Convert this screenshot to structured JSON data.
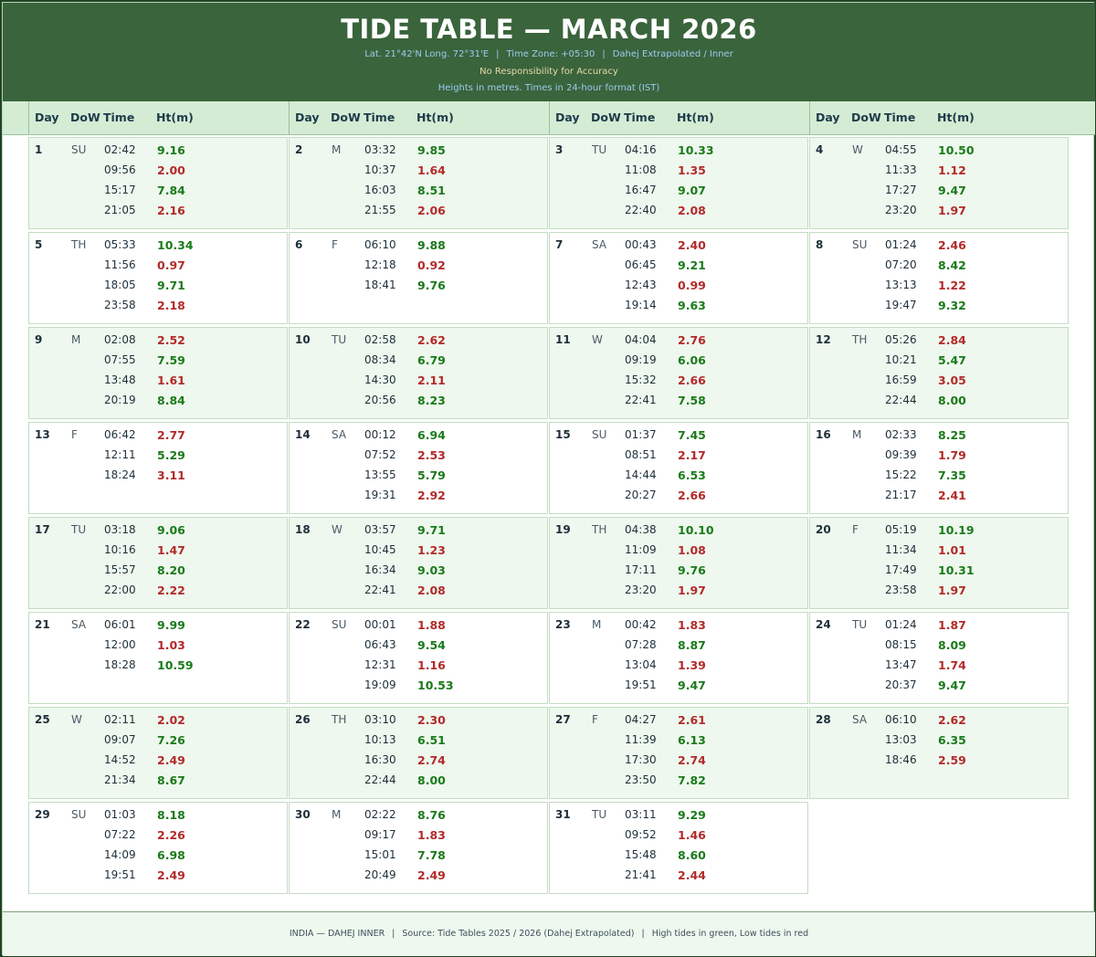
{
  "header": {
    "title": "TIDE TABLE — MARCH 2026",
    "location_line": {
      "coords": "Lat. 21°42'N  Long. 72°31'E",
      "timezone": "Time Zone: +05:30",
      "station": "Dahej Extrapolated / Inner",
      "separator": "|"
    },
    "disclaimer": "No Responsibility for Accuracy",
    "units_note": "Heights in metres.  Times in 24-hour format (IST)"
  },
  "columns": {
    "day": "Day",
    "dow": "DoW",
    "time": "Time",
    "height": "Ht(m)"
  },
  "days": [
    {
      "day": "1",
      "dow": "SU",
      "tides": [
        {
          "t": "02:42",
          "h": "9.16",
          "type": "high"
        },
        {
          "t": "09:56",
          "h": "2.00",
          "type": "low"
        },
        {
          "t": "15:17",
          "h": "7.84",
          "type": "high"
        },
        {
          "t": "21:05",
          "h": "2.16",
          "type": "low"
        }
      ]
    },
    {
      "day": "2",
      "dow": "M",
      "tides": [
        {
          "t": "03:32",
          "h": "9.85",
          "type": "high"
        },
        {
          "t": "10:37",
          "h": "1.64",
          "type": "low"
        },
        {
          "t": "16:03",
          "h": "8.51",
          "type": "high"
        },
        {
          "t": "21:55",
          "h": "2.06",
          "type": "low"
        }
      ]
    },
    {
      "day": "3",
      "dow": "TU",
      "tides": [
        {
          "t": "04:16",
          "h": "10.33",
          "type": "high"
        },
        {
          "t": "11:08",
          "h": "1.35",
          "type": "low"
        },
        {
          "t": "16:47",
          "h": "9.07",
          "type": "high"
        },
        {
          "t": "22:40",
          "h": "2.08",
          "type": "low"
        }
      ]
    },
    {
      "day": "4",
      "dow": "W",
      "tides": [
        {
          "t": "04:55",
          "h": "10.50",
          "type": "high"
        },
        {
          "t": "11:33",
          "h": "1.12",
          "type": "low"
        },
        {
          "t": "17:27",
          "h": "9.47",
          "type": "high"
        },
        {
          "t": "23:20",
          "h": "1.97",
          "type": "low"
        }
      ]
    },
    {
      "day": "5",
      "dow": "TH",
      "tides": [
        {
          "t": "05:33",
          "h": "10.34",
          "type": "high"
        },
        {
          "t": "11:56",
          "h": "0.97",
          "type": "low"
        },
        {
          "t": "18:05",
          "h": "9.71",
          "type": "high"
        },
        {
          "t": "23:58",
          "h": "2.18",
          "type": "low"
        }
      ]
    },
    {
      "day": "6",
      "dow": "F",
      "tides": [
        {
          "t": "06:10",
          "h": "9.88",
          "type": "high"
        },
        {
          "t": "12:18",
          "h": "0.92",
          "type": "low"
        },
        {
          "t": "18:41",
          "h": "9.76",
          "type": "high"
        }
      ]
    },
    {
      "day": "7",
      "dow": "SA",
      "tides": [
        {
          "t": "00:43",
          "h": "2.40",
          "type": "low"
        },
        {
          "t": "06:45",
          "h": "9.21",
          "type": "high"
        },
        {
          "t": "12:43",
          "h": "0.99",
          "type": "low"
        },
        {
          "t": "19:14",
          "h": "9.63",
          "type": "high"
        }
      ]
    },
    {
      "day": "8",
      "dow": "SU",
      "tides": [
        {
          "t": "01:24",
          "h": "2.46",
          "type": "low"
        },
        {
          "t": "07:20",
          "h": "8.42",
          "type": "high"
        },
        {
          "t": "13:13",
          "h": "1.22",
          "type": "low"
        },
        {
          "t": "19:47",
          "h": "9.32",
          "type": "high"
        }
      ]
    },
    {
      "day": "9",
      "dow": "M",
      "tides": [
        {
          "t": "02:08",
          "h": "2.52",
          "type": "low"
        },
        {
          "t": "07:55",
          "h": "7.59",
          "type": "high"
        },
        {
          "t": "13:48",
          "h": "1.61",
          "type": "low"
        },
        {
          "t": "20:19",
          "h": "8.84",
          "type": "high"
        }
      ]
    },
    {
      "day": "10",
      "dow": "TU",
      "tides": [
        {
          "t": "02:58",
          "h": "2.62",
          "type": "low"
        },
        {
          "t": "08:34",
          "h": "6.79",
          "type": "high"
        },
        {
          "t": "14:30",
          "h": "2.11",
          "type": "low"
        },
        {
          "t": "20:56",
          "h": "8.23",
          "type": "high"
        }
      ]
    },
    {
      "day": "11",
      "dow": "W",
      "tides": [
        {
          "t": "04:04",
          "h": "2.76",
          "type": "low"
        },
        {
          "t": "09:19",
          "h": "6.06",
          "type": "high"
        },
        {
          "t": "15:32",
          "h": "2.66",
          "type": "low"
        },
        {
          "t": "22:41",
          "h": "7.58",
          "type": "high"
        }
      ]
    },
    {
      "day": "12",
      "dow": "TH",
      "tides": [
        {
          "t": "05:26",
          "h": "2.84",
          "type": "low"
        },
        {
          "t": "10:21",
          "h": "5.47",
          "type": "high"
        },
        {
          "t": "16:59",
          "h": "3.05",
          "type": "low"
        },
        {
          "t": "22:44",
          "h": "8.00",
          "type": "high"
        }
      ]
    },
    {
      "day": "13",
      "dow": "F",
      "tides": [
        {
          "t": "06:42",
          "h": "2.77",
          "type": "low"
        },
        {
          "t": "12:11",
          "h": "5.29",
          "type": "high"
        },
        {
          "t": "18:24",
          "h": "3.11",
          "type": "low"
        }
      ]
    },
    {
      "day": "14",
      "dow": "SA",
      "tides": [
        {
          "t": "00:12",
          "h": "6.94",
          "type": "high"
        },
        {
          "t": "07:52",
          "h": "2.53",
          "type": "low"
        },
        {
          "t": "13:55",
          "h": "5.79",
          "type": "high"
        },
        {
          "t": "19:31",
          "h": "2.92",
          "type": "low"
        }
      ]
    },
    {
      "day": "15",
      "dow": "SU",
      "tides": [
        {
          "t": "01:37",
          "h": "7.45",
          "type": "high"
        },
        {
          "t": "08:51",
          "h": "2.17",
          "type": "low"
        },
        {
          "t": "14:44",
          "h": "6.53",
          "type": "high"
        },
        {
          "t": "20:27",
          "h": "2.66",
          "type": "low"
        }
      ]
    },
    {
      "day": "16",
      "dow": "M",
      "tides": [
        {
          "t": "02:33",
          "h": "8.25",
          "type": "high"
        },
        {
          "t": "09:39",
          "h": "1.79",
          "type": "low"
        },
        {
          "t": "15:22",
          "h": "7.35",
          "type": "high"
        },
        {
          "t": "21:17",
          "h": "2.41",
          "type": "low"
        }
      ]
    },
    {
      "day": "17",
      "dow": "TU",
      "tides": [
        {
          "t": "03:18",
          "h": "9.06",
          "type": "high"
        },
        {
          "t": "10:16",
          "h": "1.47",
          "type": "low"
        },
        {
          "t": "15:57",
          "h": "8.20",
          "type": "high"
        },
        {
          "t": "22:00",
          "h": "2.22",
          "type": "low"
        }
      ]
    },
    {
      "day": "18",
      "dow": "W",
      "tides": [
        {
          "t": "03:57",
          "h": "9.71",
          "type": "high"
        },
        {
          "t": "10:45",
          "h": "1.23",
          "type": "low"
        },
        {
          "t": "16:34",
          "h": "9.03",
          "type": "high"
        },
        {
          "t": "22:41",
          "h": "2.08",
          "type": "low"
        }
      ]
    },
    {
      "day": "19",
      "dow": "TH",
      "tides": [
        {
          "t": "04:38",
          "h": "10.10",
          "type": "high"
        },
        {
          "t": "11:09",
          "h": "1.08",
          "type": "low"
        },
        {
          "t": "17:11",
          "h": "9.76",
          "type": "high"
        },
        {
          "t": "23:20",
          "h": "1.97",
          "type": "low"
        }
      ]
    },
    {
      "day": "20",
      "dow": "F",
      "tides": [
        {
          "t": "05:19",
          "h": "10.19",
          "type": "high"
        },
        {
          "t": "11:34",
          "h": "1.01",
          "type": "low"
        },
        {
          "t": "17:49",
          "h": "10.31",
          "type": "high"
        },
        {
          "t": "23:58",
          "h": "1.97",
          "type": "low"
        }
      ]
    },
    {
      "day": "21",
      "dow": "SA",
      "tides": [
        {
          "t": "06:01",
          "h": "9.99",
          "type": "high"
        },
        {
          "t": "12:00",
          "h": "1.03",
          "type": "low"
        },
        {
          "t": "18:28",
          "h": "10.59",
          "type": "high"
        }
      ]
    },
    {
      "day": "22",
      "dow": "SU",
      "tides": [
        {
          "t": "00:01",
          "h": "1.88",
          "type": "low"
        },
        {
          "t": "06:43",
          "h": "9.54",
          "type": "high"
        },
        {
          "t": "12:31",
          "h": "1.16",
          "type": "low"
        },
        {
          "t": "19:09",
          "h": "10.53",
          "type": "high"
        }
      ]
    },
    {
      "day": "23",
      "dow": "M",
      "tides": [
        {
          "t": "00:42",
          "h": "1.83",
          "type": "low"
        },
        {
          "t": "07:28",
          "h": "8.87",
          "type": "high"
        },
        {
          "t": "13:04",
          "h": "1.39",
          "type": "low"
        },
        {
          "t": "19:51",
          "h": "9.47",
          "type": "high"
        }
      ]
    },
    {
      "day": "24",
      "dow": "TU",
      "tides": [
        {
          "t": "01:24",
          "h": "1.87",
          "type": "low"
        },
        {
          "t": "08:15",
          "h": "8.09",
          "type": "high"
        },
        {
          "t": "13:47",
          "h": "1.74",
          "type": "low"
        },
        {
          "t": "20:37",
          "h": "9.47",
          "type": "high"
        }
      ]
    },
    {
      "day": "25",
      "dow": "W",
      "tides": [
        {
          "t": "02:11",
          "h": "2.02",
          "type": "low"
        },
        {
          "t": "09:07",
          "h": "7.26",
          "type": "high"
        },
        {
          "t": "14:52",
          "h": "2.49",
          "type": "low"
        },
        {
          "t": "21:34",
          "h": "8.67",
          "type": "high"
        }
      ]
    },
    {
      "day": "26",
      "dow": "TH",
      "tides": [
        {
          "t": "03:10",
          "h": "2.30",
          "type": "low"
        },
        {
          "t": "10:13",
          "h": "6.51",
          "type": "high"
        },
        {
          "t": "16:30",
          "h": "2.74",
          "type": "low"
        },
        {
          "t": "22:44",
          "h": "8.00",
          "type": "high"
        }
      ]
    },
    {
      "day": "27",
      "dow": "F",
      "tides": [
        {
          "t": "04:27",
          "h": "2.61",
          "type": "low"
        },
        {
          "t": "11:39",
          "h": "6.13",
          "type": "high"
        },
        {
          "t": "17:30",
          "h": "2.74",
          "type": "low"
        },
        {
          "t": "23:50",
          "h": "7.82",
          "type": "high"
        }
      ]
    },
    {
      "day": "28",
      "dow": "SA",
      "tides": [
        {
          "t": "06:10",
          "h": "2.62",
          "type": "low"
        },
        {
          "t": "13:03",
          "h": "6.35",
          "type": "high"
        },
        {
          "t": "18:46",
          "h": "2.59",
          "type": "low"
        }
      ]
    },
    {
      "day": "29",
      "dow": "SU",
      "tides": [
        {
          "t": "01:03",
          "h": "8.18",
          "type": "high"
        },
        {
          "t": "07:22",
          "h": "2.26",
          "type": "low"
        },
        {
          "t": "14:09",
          "h": "6.98",
          "type": "high"
        },
        {
          "t": "19:51",
          "h": "2.49",
          "type": "low"
        }
      ]
    },
    {
      "day": "30",
      "dow": "M",
      "tides": [
        {
          "t": "02:22",
          "h": "8.76",
          "type": "high"
        },
        {
          "t": "09:17",
          "h": "1.83",
          "type": "low"
        },
        {
          "t": "15:01",
          "h": "7.78",
          "type": "high"
        },
        {
          "t": "20:49",
          "h": "2.49",
          "type": "low"
        }
      ]
    },
    {
      "day": "31",
      "dow": "TU",
      "tides": [
        {
          "t": "03:11",
          "h": "9.29",
          "type": "high"
        },
        {
          "t": "09:52",
          "h": "1.46",
          "type": "low"
        },
        {
          "t": "15:48",
          "h": "8.60",
          "type": "high"
        },
        {
          "t": "21:41",
          "h": "2.44",
          "type": "low"
        }
      ]
    }
  ],
  "footer": {
    "country_station": "INDIA — DAHEJ INNER",
    "source": "Source: Tide Tables 2025 / 2026 (Dahej Extrapolated)",
    "legend": "High tides in green, Low tides in red",
    "separator": "|"
  },
  "colors": {
    "header_bg": "#3a643c",
    "high_tide": "#1a7a1a",
    "low_tide": "#b22a2a",
    "shaded_row": "#eef8ee",
    "column_header_bg": "#d4ecd4"
  }
}
